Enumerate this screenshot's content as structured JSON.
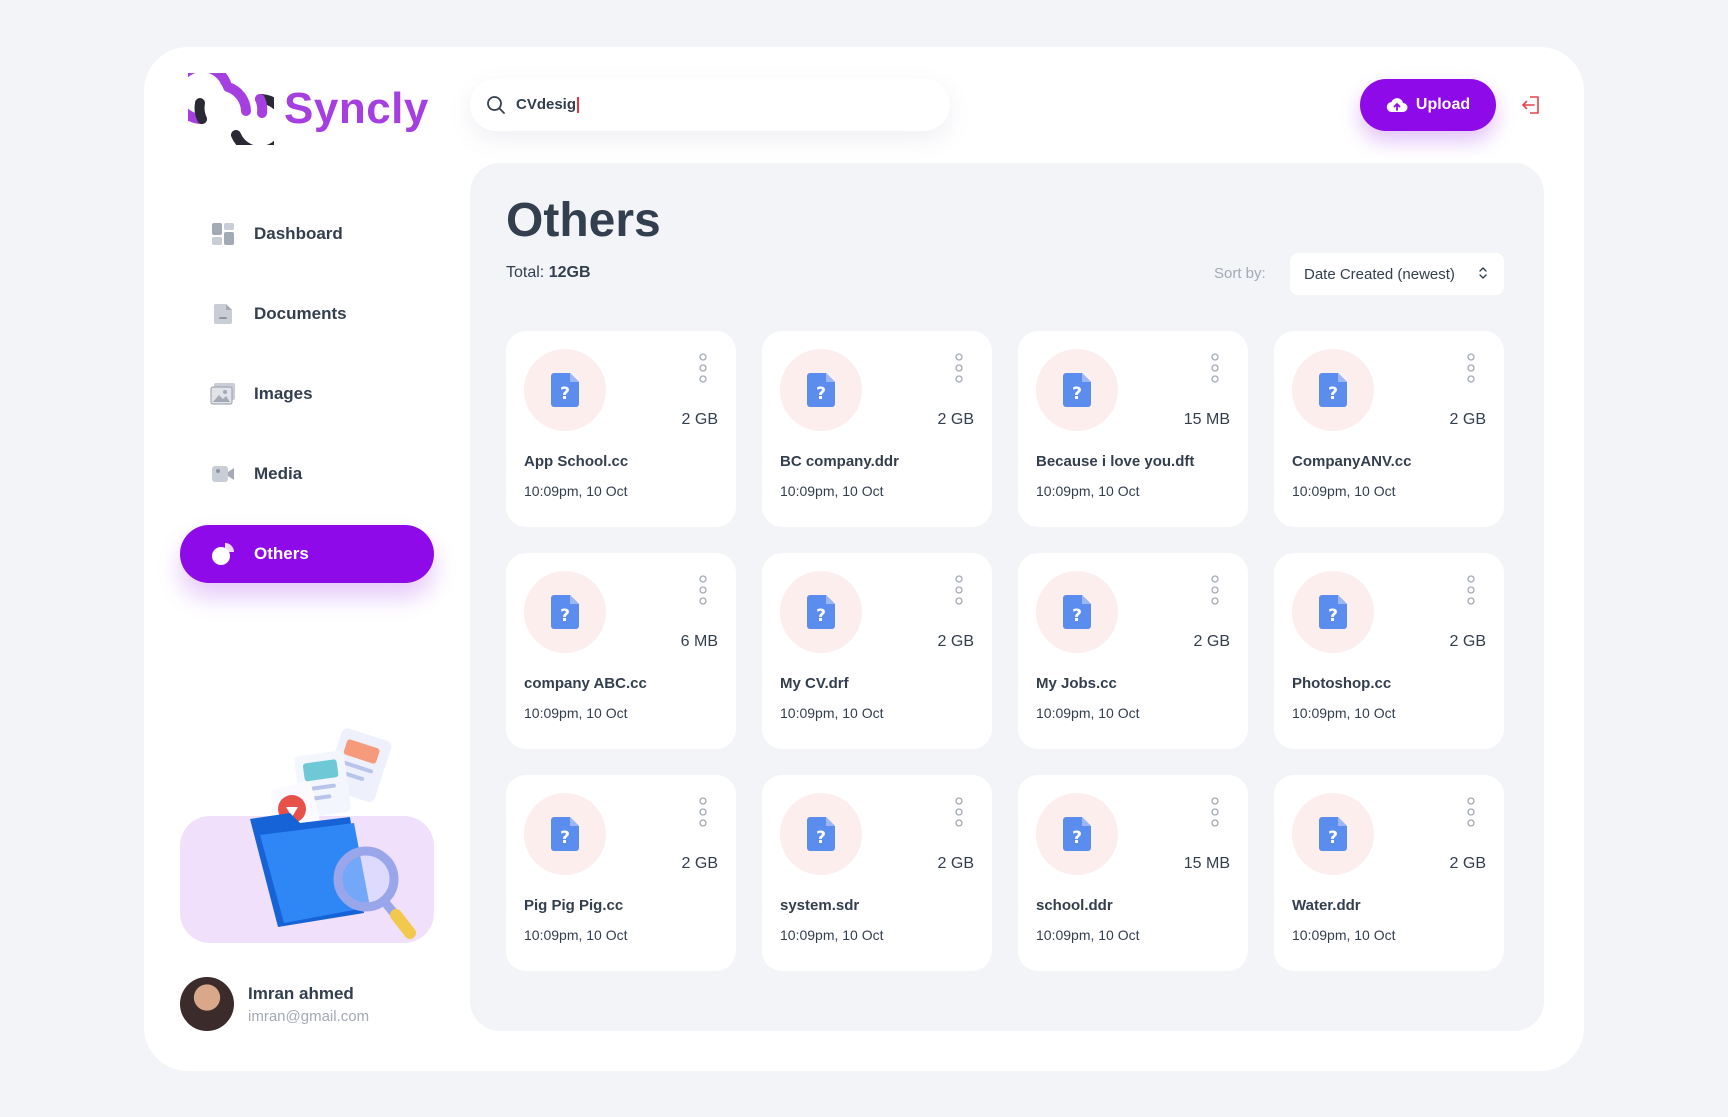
{
  "app": {
    "name": "Syncly"
  },
  "search": {
    "value": "CVdesig"
  },
  "header": {
    "upload_label": "Upload"
  },
  "sidebar": {
    "items": [
      {
        "label": "Dashboard",
        "icon": "dashboard-icon"
      },
      {
        "label": "Documents",
        "icon": "documents-icon"
      },
      {
        "label": "Images",
        "icon": "images-icon"
      },
      {
        "label": "Media",
        "icon": "media-icon"
      },
      {
        "label": "Others",
        "icon": "others-icon",
        "active": true
      }
    ]
  },
  "user": {
    "name": "Imran ahmed",
    "email": "imran@gmail.com"
  },
  "main": {
    "title": "Others",
    "total_label": "Total:",
    "total_value": "12GB",
    "sort_label": "Sort by:",
    "sort_value": "Date Created (newest)"
  },
  "files": [
    {
      "name": "App School.cc",
      "size": "2 GB",
      "date": "10:09pm, 10 Oct"
    },
    {
      "name": "BC company.ddr",
      "size": "2 GB",
      "date": "10:09pm, 10 Oct"
    },
    {
      "name": "Because i love you.dft",
      "size": "15 MB",
      "date": "10:09pm, 10 Oct"
    },
    {
      "name": "CompanyANV.cc",
      "size": "2 GB",
      "date": "10:09pm, 10 Oct"
    },
    {
      "name": "company ABC.cc",
      "size": "6 MB",
      "date": "10:09pm, 10 Oct"
    },
    {
      "name": "My CV.drf",
      "size": "2 GB",
      "date": "10:09pm, 10 Oct"
    },
    {
      "name": "My Jobs.cc",
      "size": "2 GB",
      "date": "10:09pm, 10 Oct"
    },
    {
      "name": "Photoshop.cc",
      "size": "2 GB",
      "date": "10:09pm, 10 Oct"
    },
    {
      "name": "Pig Pig Pig.cc",
      "size": "2 GB",
      "date": "10:09pm, 10 Oct"
    },
    {
      "name": "system.sdr",
      "size": "2 GB",
      "date": "10:09pm, 10 Oct"
    },
    {
      "name": "school.ddr",
      "size": "15 MB",
      "date": "10:09pm, 10 Oct"
    },
    {
      "name": "Water.ddr",
      "size": "2 GB",
      "date": "10:09pm, 10 Oct"
    }
  ],
  "colors": {
    "brand": "#8f0ae8",
    "logo_text": "#a63fe0",
    "panel_bg": "#f2f4f8",
    "file_icon": "#5b8dee",
    "thumb_bg": "#fdeeee",
    "logout": "#e8414a"
  }
}
